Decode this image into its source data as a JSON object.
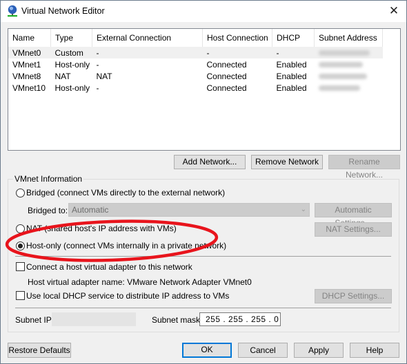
{
  "window": {
    "title": "Virtual Network Editor",
    "icon": "network-globe-icon",
    "close_glyph": "✕"
  },
  "network_table": {
    "columns": [
      "Name",
      "Type",
      "External Connection",
      "Host Connection",
      "DHCP",
      "Subnet Address"
    ],
    "rows": [
      {
        "name": "VMnet0",
        "type": "Custom",
        "external": "-",
        "host": "-",
        "dhcp": "-",
        "subnet": "(blurred)",
        "selected": true
      },
      {
        "name": "VMnet1",
        "type": "Host-only",
        "external": "-",
        "host": "Connected",
        "dhcp": "Enabled",
        "subnet": "(blurred)",
        "selected": false
      },
      {
        "name": "VMnet8",
        "type": "NAT",
        "external": "NAT",
        "host": "Connected",
        "dhcp": "Enabled",
        "subnet": "(blurred)",
        "selected": false
      },
      {
        "name": "VMnet10",
        "type": "Host-only",
        "external": "-",
        "host": "Connected",
        "dhcp": "Enabled",
        "subnet": "(blurred)",
        "selected": false
      }
    ]
  },
  "table_buttons": {
    "add": "Add Network...",
    "remove": "Remove Network",
    "rename": "Rename Network..."
  },
  "vmnet_info": {
    "group_label": "VMnet Information",
    "bridged_label": "Bridged (connect VMs directly to the external network)",
    "bridged_to_label": "Bridged to:",
    "bridged_to_value": "Automatic",
    "automatic_settings": "Automatic Settings...",
    "nat_label": "NAT (shared host's IP address with VMs)",
    "nat_settings": "NAT Settings...",
    "hostonly_label": "Host-only (connect VMs internally in a private network)",
    "selected_mode": "host-only",
    "connect_adapter_label": "Connect a host virtual adapter to this network",
    "connect_adapter_checked": false,
    "adapter_name_label": "Host virtual adapter name: VMware Network Adapter VMnet0",
    "dhcp_label": "Use local DHCP service to distribute IP address to VMs",
    "dhcp_checked": false,
    "dhcp_settings": "DHCP Settings...",
    "subnet_ip_label": "Subnet IP:",
    "subnet_ip_value": "(blurred)",
    "subnet_mask_label": "Subnet mask:",
    "subnet_mask_value": "255 . 255 . 255 .  0"
  },
  "footer": {
    "restore": "Restore Defaults",
    "ok": "OK",
    "cancel": "Cancel",
    "apply": "Apply",
    "help": "Help"
  },
  "annotation": {
    "shape": "ellipse",
    "color": "#e8141c",
    "target": "host-only-radio"
  }
}
